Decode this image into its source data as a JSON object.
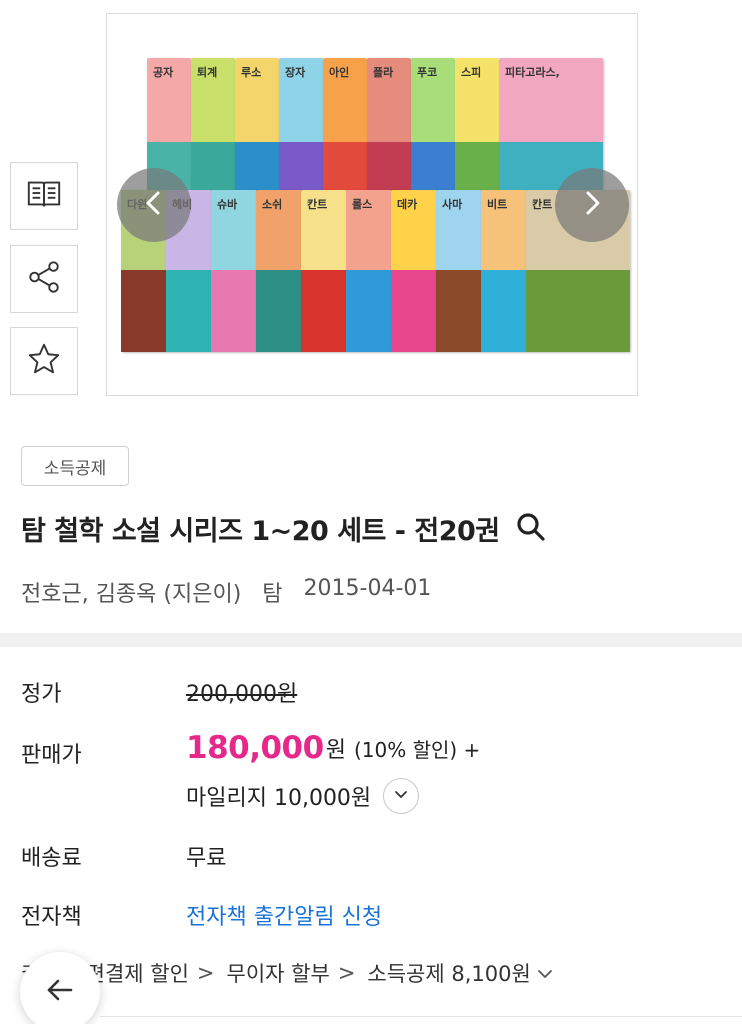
{
  "side_actions": {
    "preview_icon": "book-open-icon",
    "share_icon": "share-icon",
    "favorite_icon": "star-icon"
  },
  "product_image": {
    "top_row_labels": [
      "공자",
      "퇴계",
      "루소",
      "장자",
      "아인",
      "플라",
      "푸코",
      "스피",
      "피타고라스,"
    ],
    "bottom_row_labels": [
      "다윈",
      "헤비",
      "슈바",
      "소쉬",
      "칸트",
      "롤스",
      "데카",
      "사마",
      "비트",
      "칸트"
    ],
    "prev_icon": "chevron-left-icon",
    "next_icon": "chevron-right-icon"
  },
  "badge": {
    "label": "소득공제"
  },
  "product": {
    "title": "탐 철학 소설 시리즈 1~20 세트 - 전20권",
    "authors": "전호근, 김종옥 (지은이)",
    "publisher": "탐",
    "pub_date": "2015-04-01"
  },
  "price": {
    "list_label": "정가",
    "list_value": "200,000원",
    "sale_label": "판매가",
    "sale_value": "180,000",
    "sale_unit": "원",
    "sale_extra": "(10% 할인) +",
    "mileage": "마일리지 10,000원",
    "shipping_label": "배송료",
    "shipping_value": "무료",
    "ebook_label": "전자책",
    "ebook_link": "전자책 출간알림 신청"
  },
  "benefits": {
    "item1": "카드·간편결제 할인",
    "item2": "무이자 할부",
    "item3": "소득공제 8,100원"
  },
  "colors": {
    "sale_price": "#e6288a",
    "link": "#1a73d9"
  }
}
